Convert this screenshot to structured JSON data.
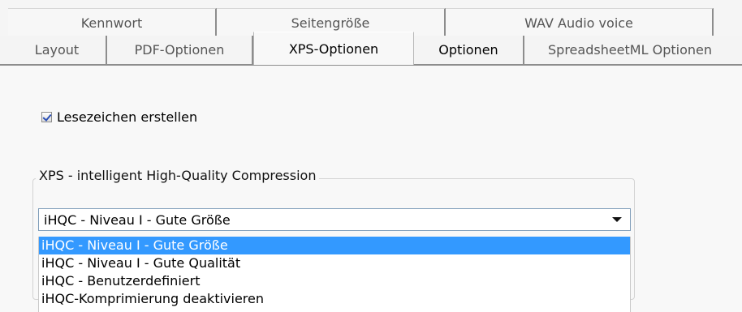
{
  "tabs": {
    "back_row": [
      {
        "label": "Kennwort"
      },
      {
        "label": "Seitengröße"
      },
      {
        "label": "WAV Audio voice"
      }
    ],
    "front_row": [
      {
        "label": "Layout"
      },
      {
        "label": "PDF-Optionen"
      },
      {
        "label": "XPS-Optionen"
      },
      {
        "label": "Optionen"
      },
      {
        "label": "SpreadsheetML Optionen"
      }
    ],
    "selected": "XPS-Optionen"
  },
  "settings": {
    "bookmark_checkbox_label": "Lesezeichen erstellen",
    "bookmark_checked": true,
    "compression_group_label": "XPS - intelligent High-Quality Compression",
    "selected_compression": "iHQC - Niveau I - Gute Größe",
    "options": [
      "iHQC - Niveau I - Gute Größe",
      "iHQC - Niveau I - Gute Qualität",
      "iHQC - Benutzerdefiniert",
      "iHQC-Komprimierung deaktivieren"
    ]
  },
  "colors": {
    "selection": "#3399ff",
    "border": "#8d8d8d",
    "background": "#f5f5f5",
    "checkmark": "#2b4fb5"
  }
}
